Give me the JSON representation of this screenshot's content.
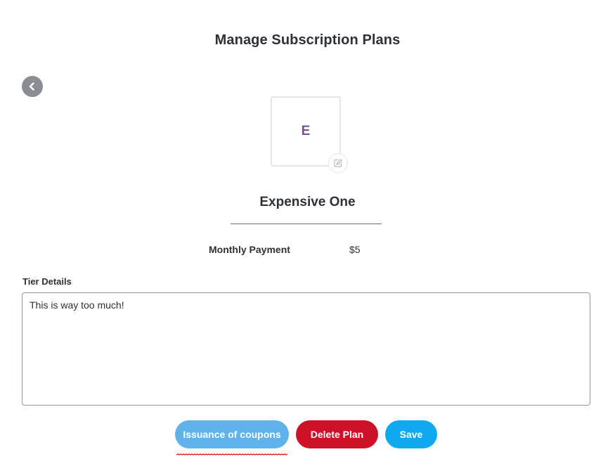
{
  "header": {
    "title": "Manage Subscription Plans"
  },
  "navigation": {
    "back_icon": "chevron-left-icon"
  },
  "plan": {
    "avatar_letter": "E",
    "edit_icon": "edit-icon",
    "name": "Expensive One",
    "monthly_payment_label": "Monthly Payment",
    "monthly_payment_value": "$5"
  },
  "tier_details": {
    "label": "Tier Details",
    "value": "This is way too much!"
  },
  "actions": {
    "coupons_label": "Issuance of coupons",
    "delete_label": "Delete Plan",
    "save_label": "Save"
  },
  "colors": {
    "coupons_button": "#5fb3ea",
    "delete_button": "#cc1128",
    "save_button": "#10a9f0",
    "avatar_letter": "#7a4e93",
    "error_underline": "#e02020"
  }
}
